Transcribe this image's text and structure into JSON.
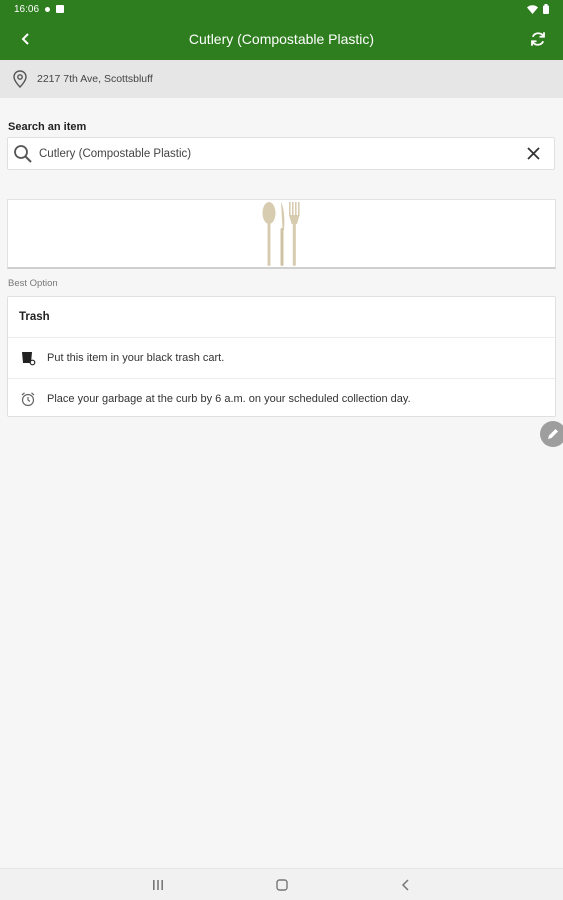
{
  "status_bar": {
    "time": "16:06"
  },
  "app_bar": {
    "title": "Cutlery (Compostable Plastic)"
  },
  "address": {
    "text": "2217 7th Ave, Scottsbluff"
  },
  "search": {
    "label": "Search an item",
    "value": "Cutlery (Compostable Plastic)"
  },
  "best_option": {
    "label": "Best Option",
    "card_title": "Trash",
    "rows": [
      {
        "icon": "trash-cart-icon",
        "text": "Put this item in your black trash cart."
      },
      {
        "icon": "alarm-clock-icon",
        "text": "Place your garbage at the curb by 6 a.m. on your scheduled collection day."
      }
    ]
  },
  "colors": {
    "brand_green": "#2e7d1f",
    "cutlery_wood": "#d8ccb0"
  }
}
